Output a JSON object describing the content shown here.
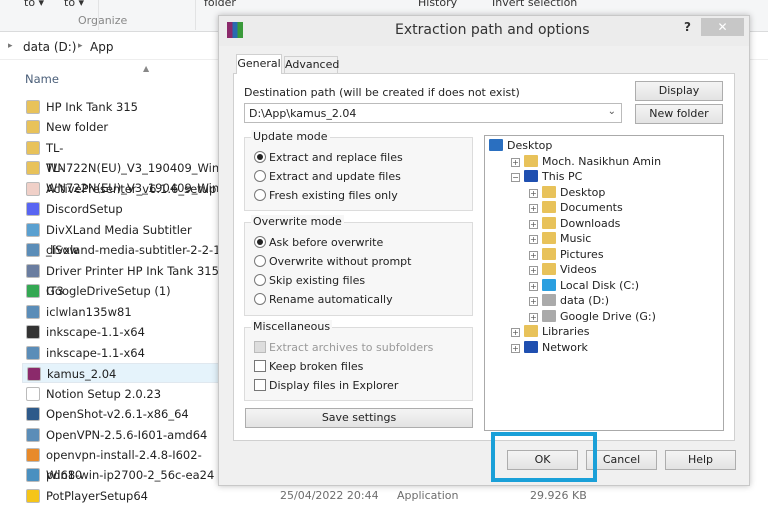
{
  "ribbon": {
    "move_to": "to ▾",
    "copy_to": "to ▾",
    "organize": "Organize",
    "new_folder": "folder",
    "history": "History",
    "invert_selection": "Invert selection"
  },
  "address": {
    "sep1": "▸",
    "drive": "data (D:)",
    "sep2": "▸",
    "folder": "App"
  },
  "list": {
    "name_header": "Name",
    "files": [
      {
        "name": "HP Ink Tank 315",
        "icon": "folder-icon",
        "color": "#e8c25a"
      },
      {
        "name": "New folder",
        "icon": "folder-icon",
        "color": "#e8c25a"
      },
      {
        "name": "TL-WN722N(EU)_V3_190409_Win8",
        "icon": "folder-icon",
        "color": "#e8c25a"
      },
      {
        "name": "TL-WN722N(EU)_V3_190409_Win8",
        "icon": "folder-icon",
        "color": "#e8c25a"
      },
      {
        "name": "ActivePresenter_v6.1.6_setup",
        "icon": "activepresenter-icon",
        "color": "#f0d0c8"
      },
      {
        "name": "DiscordSetup",
        "icon": "discord-icon",
        "color": "#5865f2"
      },
      {
        "name": "DivXLand Media Subtitler _ISow",
        "icon": "divxland-icon",
        "color": "#5aa0d0"
      },
      {
        "name": "divxland-media-subtitler-2-2-1",
        "icon": "installer-icon",
        "color": "#5b8db8"
      },
      {
        "name": "Driver Printer HP Ink Tank 315 IT3",
        "icon": "installer-icon",
        "color": "#6a7da0"
      },
      {
        "name": "GoogleDriveSetup (1)",
        "icon": "google-drive-icon",
        "color": "#34a853"
      },
      {
        "name": "iclwlan135w81",
        "icon": "installer-icon",
        "color": "#5b8db8"
      },
      {
        "name": "inkscape-1.1-x64",
        "icon": "inkscape-icon",
        "color": "#333333"
      },
      {
        "name": "inkscape-1.1-x64",
        "icon": "installer-icon",
        "color": "#5b8db8"
      },
      {
        "name": "kamus_2.04",
        "icon": "winrar-icon",
        "color": "#8b2a6b",
        "selected": true
      },
      {
        "name": "Notion Setup 2.0.23",
        "icon": "notion-icon",
        "color": "#ffffff"
      },
      {
        "name": "OpenShot-v2.6.1-x86_64",
        "icon": "openshot-icon",
        "color": "#2e5a8a"
      },
      {
        "name": "OpenVPN-2.5.6-I601-amd64",
        "icon": "installer-icon",
        "color": "#5b8db8"
      },
      {
        "name": "openvpn-install-2.4.8-I602-Win10",
        "icon": "openvpn-icon",
        "color": "#e88a2a"
      },
      {
        "name": "pd68-win-ip2700-2_56c-ea24",
        "icon": "printer-driver-icon",
        "color": "#4a90c0"
      },
      {
        "name": "PotPlayerSetup64",
        "icon": "potplayer-icon",
        "color": "#f5c518"
      }
    ],
    "last_row": {
      "date": "25/04/2022 20:44",
      "type": "Application",
      "size": "29.926 KB"
    }
  },
  "dialog": {
    "title": "Extraction path and options",
    "help": "?",
    "close": "✕",
    "tabs": [
      {
        "label": "General",
        "active": true
      },
      {
        "label": "Advanced"
      }
    ],
    "dest_label": "Destination path (will be created if does not exist)",
    "dest_value": "D:\\App\\kamus_2.04",
    "display_btn": "Display",
    "new_folder_btn": "New folder",
    "update_mode": {
      "caption": "Update mode",
      "options": [
        {
          "label": "Extract and replace files",
          "checked": true
        },
        {
          "label": "Extract and update files"
        },
        {
          "label": "Fresh existing files only"
        }
      ]
    },
    "overwrite_mode": {
      "caption": "Overwrite mode",
      "options": [
        {
          "label": "Ask before overwrite",
          "checked": true
        },
        {
          "label": "Overwrite without prompt"
        },
        {
          "label": "Skip existing files"
        },
        {
          "label": "Rename automatically"
        }
      ]
    },
    "misc": {
      "caption": "Miscellaneous",
      "options": [
        {
          "label": "Extract archives to subfolders",
          "disabled": true
        },
        {
          "label": "Keep broken files"
        },
        {
          "label": "Display files in Explorer"
        }
      ]
    },
    "save_settings": "Save settings",
    "tree": [
      {
        "label": "Desktop",
        "level": 0,
        "toggle": "",
        "icon": "desktop-icon",
        "color": "#2a6fc0"
      },
      {
        "label": "Moch. Nasikhun Amin",
        "level": 1,
        "toggle": "+",
        "icon": "user-folder-icon",
        "color": "#e8c25a"
      },
      {
        "label": "This PC",
        "level": 1,
        "toggle": "−",
        "icon": "computer-icon",
        "color": "#1f4fb0"
      },
      {
        "label": "Desktop",
        "level": 2,
        "toggle": "+",
        "icon": "desktop-folder-icon",
        "color": "#e8c25a"
      },
      {
        "label": "Documents",
        "level": 2,
        "toggle": "+",
        "icon": "documents-folder-icon",
        "color": "#e8c25a"
      },
      {
        "label": "Downloads",
        "level": 2,
        "toggle": "+",
        "icon": "downloads-folder-icon",
        "color": "#e8c25a"
      },
      {
        "label": "Music",
        "level": 2,
        "toggle": "+",
        "icon": "music-folder-icon",
        "color": "#e8c25a"
      },
      {
        "label": "Pictures",
        "level": 2,
        "toggle": "+",
        "icon": "pictures-folder-icon",
        "color": "#e8c25a"
      },
      {
        "label": "Videos",
        "level": 2,
        "toggle": "+",
        "icon": "videos-folder-icon",
        "color": "#e8c25a"
      },
      {
        "label": "Local Disk (C:)",
        "level": 2,
        "toggle": "+",
        "icon": "windows-drive-icon",
        "color": "#2a9fe0"
      },
      {
        "label": "data (D:)",
        "level": 2,
        "toggle": "+",
        "icon": "drive-icon",
        "color": "#aaaaaa"
      },
      {
        "label": "Google Drive (G:)",
        "level": 2,
        "toggle": "+",
        "icon": "drive-icon",
        "color": "#aaaaaa"
      },
      {
        "label": "Libraries",
        "level": 1,
        "toggle": "+",
        "icon": "libraries-icon",
        "color": "#e8c25a"
      },
      {
        "label": "Network",
        "level": 1,
        "toggle": "+",
        "icon": "network-icon",
        "color": "#1f4fb0"
      }
    ],
    "ok": "OK",
    "cancel": "Cancel",
    "help_btn": "Help",
    "highlight_color": "#1aa0d8"
  }
}
